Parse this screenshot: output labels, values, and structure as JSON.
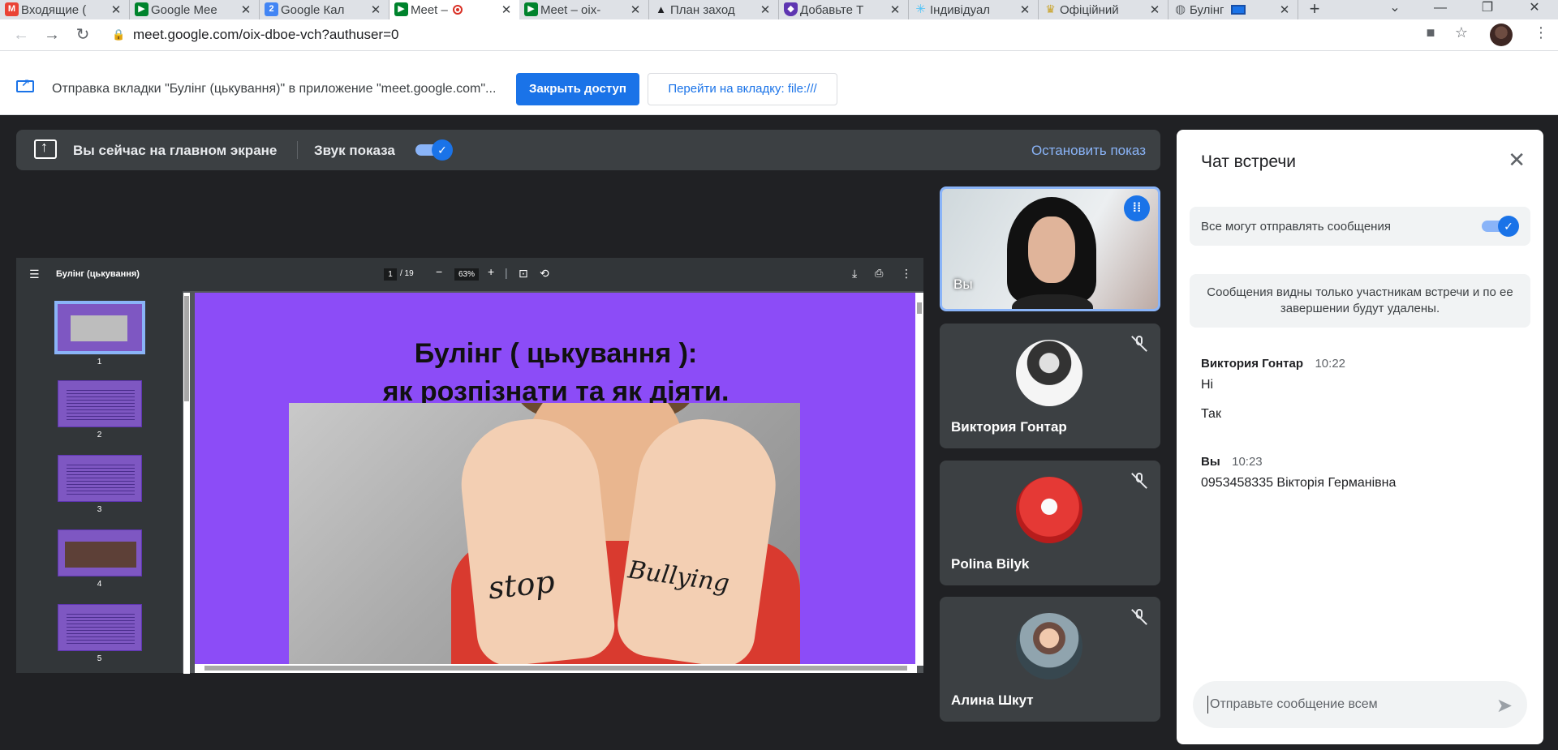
{
  "browser": {
    "tabs": [
      {
        "label": "Входящие (",
        "icon": "gmail-icon",
        "color": "#ea4335",
        "glyph": "M"
      },
      {
        "label": "Google Mee",
        "icon": "meet-icon",
        "color": "#00832d",
        "glyph": "▶"
      },
      {
        "label": "Google Кал",
        "icon": "calendar-icon",
        "color": "#4285f4",
        "glyph": "2"
      },
      {
        "label": "Meet –",
        "icon": "meet-icon",
        "color": "#00832d",
        "glyph": "▶",
        "active": true
      },
      {
        "label": "Meet – oix-",
        "icon": "meet-icon",
        "color": "#00832d",
        "glyph": "▶"
      },
      {
        "label": "План заход",
        "icon": "graduation-cap-icon",
        "color": "#202124",
        "glyph": "🎓"
      },
      {
        "label": "Добавьте Т",
        "icon": "shield-icon",
        "color": "#5e35b1",
        "glyph": "◆"
      },
      {
        "label": "Індивідуал",
        "icon": "snowflake-icon",
        "color": "#4fc3f7",
        "glyph": "✳"
      },
      {
        "label": "Офіційний",
        "icon": "crest-icon",
        "color": "#c9a227",
        "glyph": "♛"
      },
      {
        "label": "Булінг",
        "icon": "globe-icon",
        "color": "#5f6368",
        "glyph": "◍"
      }
    ],
    "new_tab": "+",
    "url": "meet.google.com/oix-dboe-vch?authuser=0"
  },
  "infobar": {
    "message": "Отправка вкладки \"Булінг (цькування)\" в приложение \"meet.google.com\"...",
    "stop_sharing": "Закрыть доступ",
    "switch_tab": "Перейти на вкладку: file:///"
  },
  "presenting": {
    "status": "Вы сейчас на главном экране",
    "sound_label": "Звук показа",
    "sound_enabled": true,
    "stop_label": "Остановить показ"
  },
  "pdf": {
    "title": "Булінг (цькування)",
    "current_page": "1",
    "total_pages": "/ 19",
    "zoom": "63%",
    "thumbnails": [
      "1",
      "2",
      "3",
      "4",
      "5"
    ],
    "slide_title_line1": "Булінг ( цькування ):",
    "slide_title_line2": "як розпізнати та як діяти.",
    "hand_left_text": "stop",
    "hand_right_text": "Bullying",
    "slide_bg": "#8c4cf7"
  },
  "participants": [
    {
      "name": "Вы",
      "self": true,
      "speaking": true
    },
    {
      "name": "Виктория Гонтар",
      "muted": true
    },
    {
      "name": "Polina Bilyk",
      "muted": true
    },
    {
      "name": "Алина Шкут",
      "muted": true
    }
  ],
  "chat": {
    "title": "Чат встречи",
    "setting_label": "Все могут отправлять сообщения",
    "setting_enabled": true,
    "notice": "Сообщения видны только участникам встречи и по ее завершении будут удалены.",
    "messages": [
      {
        "author": "Виктория Гонтар",
        "time": "10:22",
        "lines": [
          "Hi",
          "Так"
        ]
      },
      {
        "author": "Вы",
        "time": "10:23",
        "lines": [
          "0953458335 Вікторія Германівна"
        ]
      }
    ],
    "input_placeholder": "Отправьте сообщение всем"
  }
}
